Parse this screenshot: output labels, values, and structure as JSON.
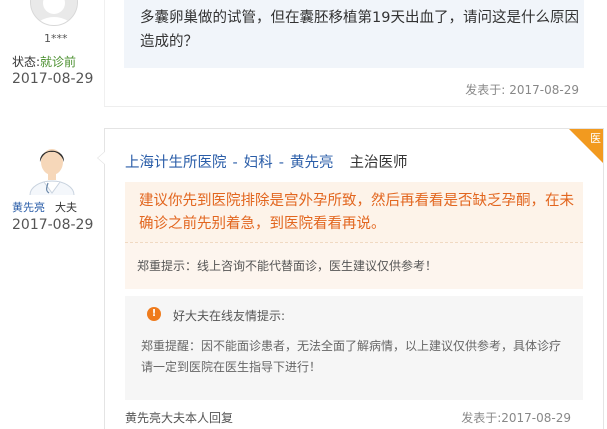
{
  "patient": {
    "name": "1***",
    "status_label": "状态:",
    "status_value": "就诊前",
    "date": "2017-08-29",
    "message": "多囊卵巢做的试管，但在囊胚移植第19天出血了，请问这是什么原因造成的？",
    "posted_label": "发表于:",
    "posted_date": "2017-08-29"
  },
  "doctor": {
    "name": "黄先亮",
    "role": "大夫",
    "date": "2017-08-29",
    "hospital": "上海计生所医院",
    "department": "妇科",
    "doctor_name": "黄先亮",
    "separator": "-",
    "rank": "主治医师",
    "badge": "医",
    "reply": "建议你先到医院排除是宫外孕所致，然后再看看是否缺乏孕酮，在未确诊之前先别着急，到医院看看再说。",
    "disclaimer": "郑重提示：线上咨询不能代替面诊，医生建议仅供参考！",
    "tip_title": "好大夫在线友情提示:",
    "tip_body": "郑重提醒：因不能面诊患者，无法全面了解病情，以上建议仅供参考，具体诊疗请一定到医院在医生指导下进行！",
    "footer_left": "黄先亮大夫本人回复",
    "footer_right": "发表于:2017-08-29"
  },
  "colors": {
    "link_blue": "#2a5da8",
    "reply_orange": "#e2661f",
    "badge_orange": "#f29a1f",
    "status_green": "#4a8f2e",
    "patient_bubble": "#f1f5fa"
  },
  "icons": [
    "default-avatar-icon",
    "doctor-avatar-icon",
    "warning-icon"
  ]
}
